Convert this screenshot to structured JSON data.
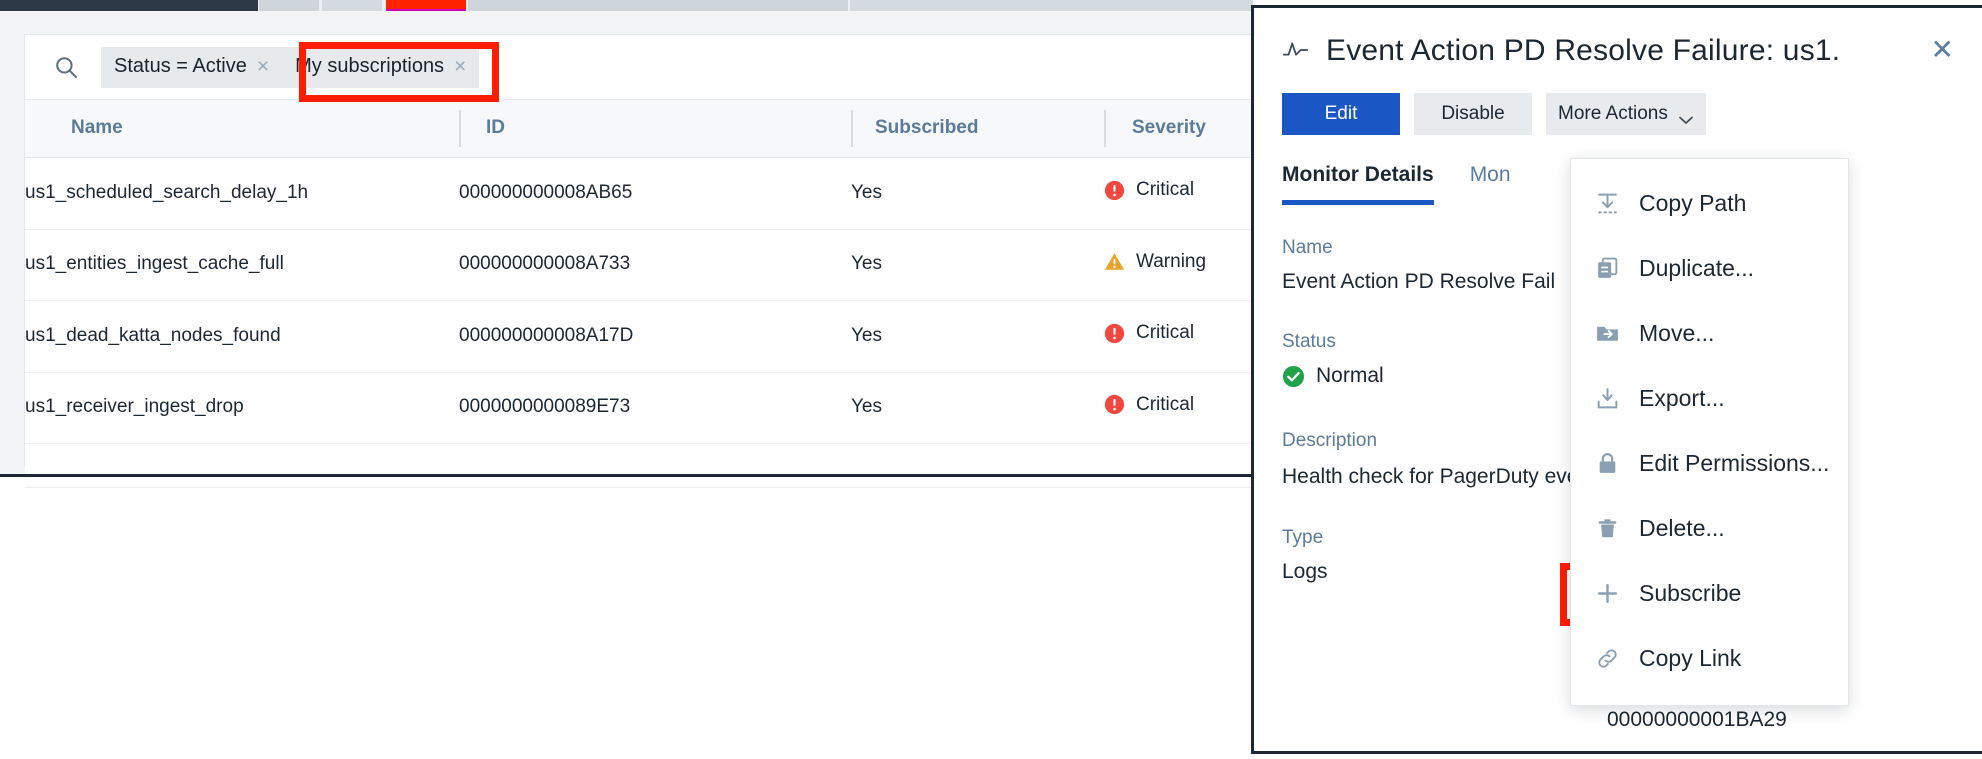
{
  "browser_strip": {
    "segments": [
      "active-tab-dark",
      "tab-2",
      "tab-3",
      "tab-red-highlight",
      "tab-5",
      "tab-6"
    ]
  },
  "list_panel": {
    "search": {
      "icon": "search-icon"
    },
    "filters": [
      {
        "label": "Status = Active",
        "remove_label": "×",
        "highlighted": false
      },
      {
        "label": "My subscriptions",
        "remove_label": "×",
        "highlighted": true
      }
    ],
    "table": {
      "columns": [
        {
          "key": "name",
          "label": "Name"
        },
        {
          "key": "id",
          "label": "ID"
        },
        {
          "key": "subscribed",
          "label": "Subscribed"
        },
        {
          "key": "severity",
          "label": "Severity"
        }
      ],
      "rows": [
        {
          "name": "us1_scheduled_search_delay_1h",
          "id": "000000000008AB65",
          "subscribed": "Yes",
          "severity": "Critical",
          "severity_icon": "critical-icon"
        },
        {
          "name": "us1_entities_ingest_cache_full",
          "id": "000000000008A733",
          "subscribed": "Yes",
          "severity": "Warning",
          "severity_icon": "warning-icon"
        },
        {
          "name": "us1_dead_katta_nodes_found",
          "id": "000000000008A17D",
          "subscribed": "Yes",
          "severity": "Critical",
          "severity_icon": "critical-icon"
        },
        {
          "name": "us1_receiver_ingest_drop",
          "id": "0000000000089E73",
          "subscribed": "Yes",
          "severity": "Critical",
          "severity_icon": "critical-icon"
        }
      ]
    }
  },
  "detail_panel": {
    "title": "Event Action PD Resolve Failure: us1.",
    "title_icon": "monitor-pulse-icon",
    "close_label": "✕",
    "actions": {
      "edit": "Edit",
      "disable": "Disable",
      "more_actions": "More Actions"
    },
    "tabs": [
      {
        "label": "Monitor Details",
        "active": true
      },
      {
        "label": "Mon",
        "active": false
      }
    ],
    "fields": {
      "name_label": "Name",
      "name_value": "Event Action PD Resolve Fail",
      "status_label": "Status",
      "status_value": "Normal",
      "status_icon": "check-circle-icon",
      "description_label": "Description",
      "description_value": "Health check for PagerDuty                    event-action",
      "type_label": "Type",
      "type_value": "Logs"
    },
    "monitor_id": "00000000001BA29",
    "more_actions_menu": [
      {
        "label": "Copy Path",
        "icon": "copy-path-icon",
        "highlighted": false
      },
      {
        "label": "Duplicate...",
        "icon": "duplicate-icon",
        "highlighted": false
      },
      {
        "label": "Move...",
        "icon": "move-folder-icon",
        "highlighted": false
      },
      {
        "label": "Export...",
        "icon": "export-icon",
        "highlighted": false
      },
      {
        "label": "Edit Permissions...",
        "icon": "lock-icon",
        "highlighted": false
      },
      {
        "label": "Delete...",
        "icon": "trash-icon",
        "highlighted": false
      },
      {
        "label": "Subscribe",
        "icon": "plus-icon",
        "highlighted": true
      },
      {
        "label": "Copy Link",
        "icon": "link-icon",
        "highlighted": false
      }
    ]
  },
  "colors": {
    "accent_blue": "#1a56c4",
    "critical_red": "#f0483e",
    "warning_amber": "#eaa32a",
    "success_green": "#1ea34a",
    "highlight_red": "#ff1d00",
    "header_text_blue": "#5b7b9c"
  }
}
